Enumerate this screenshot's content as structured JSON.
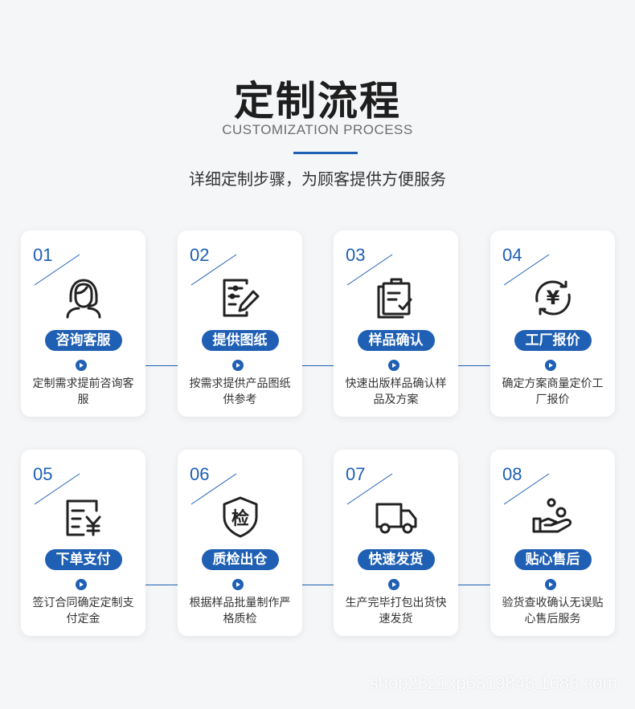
{
  "header": {
    "title": "定制流程",
    "subtitle": "CUSTOMIZATION PROCESS",
    "tagline": "详细定制步骤，为顾客提供方便服务"
  },
  "steps": [
    {
      "num": "01",
      "label": "咨询客服",
      "desc": "定制需求提前咨询客服",
      "icon": "customer-service-icon"
    },
    {
      "num": "02",
      "label": "提供图纸",
      "desc": "按需求提供产品图纸供参考",
      "icon": "document-pen-icon"
    },
    {
      "num": "03",
      "label": "样品确认",
      "desc": "快速出版样品确认样品及方案",
      "icon": "clipboard-check-icon"
    },
    {
      "num": "04",
      "label": "工厂报价",
      "desc": "确定方案商量定价工厂报价",
      "icon": "yuan-cycle-icon"
    },
    {
      "num": "05",
      "label": "下单支付",
      "desc": "签订合同确定定制支付定金",
      "icon": "invoice-yuan-icon"
    },
    {
      "num": "06",
      "label": "质检出仓",
      "desc": "根据样品批量制作严格质检",
      "icon": "shield-check-icon"
    },
    {
      "num": "07",
      "label": "快速发货",
      "desc": "生产完毕打包出货快速发货",
      "icon": "truck-icon"
    },
    {
      "num": "08",
      "label": "贴心售后",
      "desc": "验货查收确认无误贴心售后服务",
      "icon": "hand-coins-icon"
    }
  ],
  "shield_char": "检",
  "yuan_char": "¥",
  "watermark": "shop2821xp6319848.1688.com",
  "colors": {
    "accent": "#1f5fb4",
    "text": "#1e1e1e",
    "background": "#f5f6f8"
  }
}
